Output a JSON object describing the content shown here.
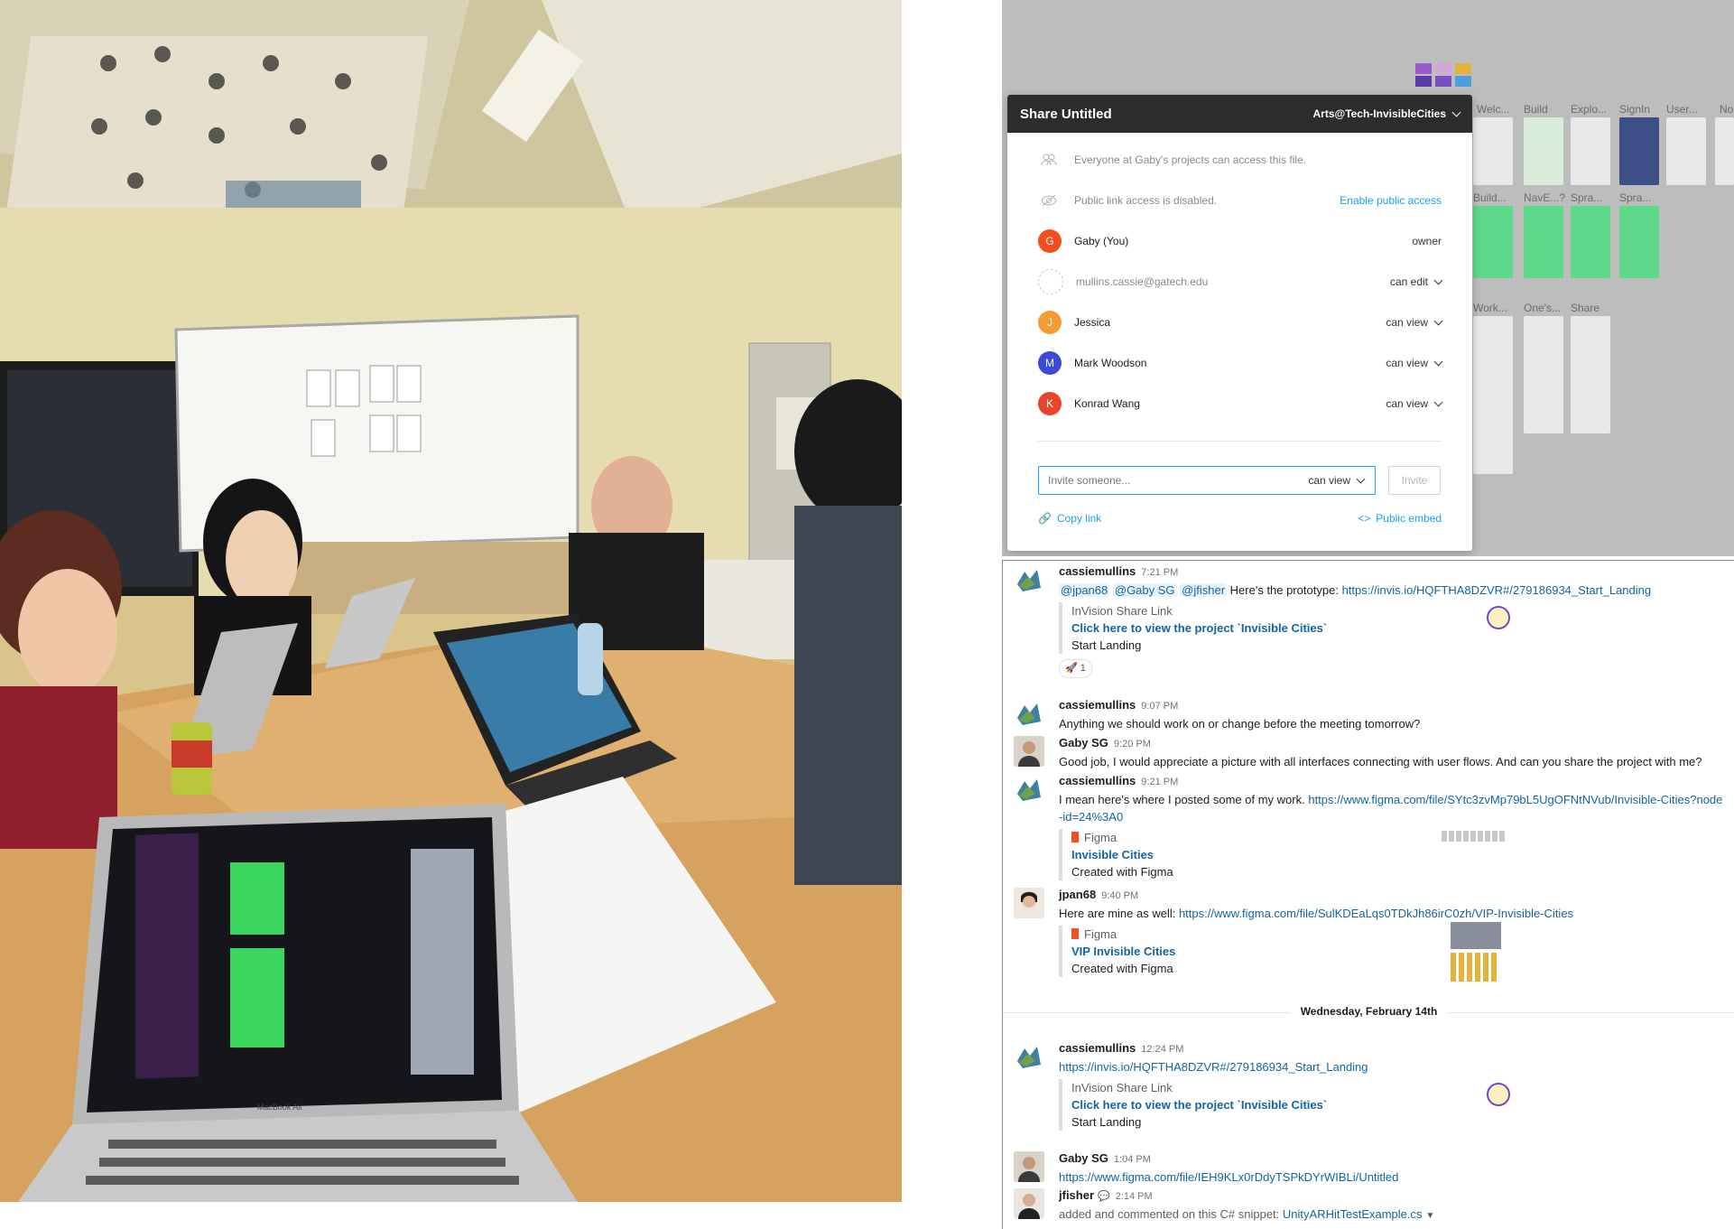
{
  "photo": {
    "description_icon": "team-meeting-photo",
    "laptop_label": "MacBook Air"
  },
  "figma": {
    "frames": [
      "Welc...",
      "Build",
      "Explo...",
      "SignIn",
      "User...",
      "No",
      "Build...",
      "NavE...?",
      "Spra...",
      "Spra...",
      "Work...",
      "One's...",
      "Share"
    ],
    "share": {
      "title": "Share Untitled",
      "team": "Arts@Tech-InvisibleCities",
      "access_everyone": "Everyone at Gaby's projects can access this file.",
      "public_link": "Public link access is disabled.",
      "enable_public": "Enable public access",
      "people": [
        {
          "initial": "G",
          "name": "Gaby (You)",
          "perm": "owner",
          "color": "#f24e1e",
          "has_dropdown": false
        },
        {
          "initial": "",
          "name": "mullins.cassie@gatech.edu",
          "perm": "can edit",
          "color": "#ffffff",
          "has_dropdown": true
        },
        {
          "initial": "J",
          "name": "Jessica",
          "perm": "can view",
          "color": "#f59b33",
          "has_dropdown": true
        },
        {
          "initial": "M",
          "name": "Mark Woodson",
          "perm": "can view",
          "color": "#3b4bd8",
          "has_dropdown": true
        },
        {
          "initial": "K",
          "name": "Konrad Wang",
          "perm": "can view",
          "color": "#e8442a",
          "has_dropdown": true
        }
      ],
      "invite_placeholder": "Invite someone...",
      "invite_perm": "can view",
      "invite_button": "Invite",
      "copy_link": "Copy link",
      "public_embed": "Public embed"
    }
  },
  "slack": {
    "m1": {
      "name": "cassiemullins",
      "time": "7:21 PM",
      "mentions": [
        "@jpan68",
        "@Gaby SG",
        "@jfisher"
      ],
      "text": "Here's the prototype:",
      "link": "https://invis.io/HQFTHA8DZVR#/279186934_Start_Landing",
      "attach_source": "InVision Share Link",
      "attach_title": "Click here to view the project `Invisible Cities`",
      "attach_desc": "Start Landing",
      "reaction": "🚀 1"
    },
    "m2": {
      "name": "cassiemullins",
      "time": "9:07 PM",
      "text": "Anything we should work on or change before the meeting tomorrow?"
    },
    "m3": {
      "name": "Gaby SG",
      "time": "9:20 PM",
      "text": "Good job, I would appreciate a picture with all interfaces connecting with user flows. And can you share the project with me?"
    },
    "m4": {
      "name": "cassiemullins",
      "time": "9:21 PM",
      "text": "I mean here's where I posted some of my work.",
      "link": "https://www.figma.com/file/SYtc3zvMp79bL5UgOFNtNVub/Invisible-Cities?node-id=24%3A0",
      "attach_source": "Figma",
      "attach_title": "Invisible Cities",
      "attach_desc": "Created with Figma"
    },
    "m5": {
      "name": "jpan68",
      "time": "9:40 PM",
      "text": "Here are mine as well:",
      "link": "https://www.figma.com/file/SulKDEaLqs0TDkJh86irC0zh/VIP-Invisible-Cities",
      "attach_source": "Figma",
      "attach_title": "VIP Invisible Cities",
      "attach_desc": "Created with Figma"
    },
    "day_divider": "Wednesday, February 14th",
    "m6": {
      "name": "cassiemullins",
      "time": "12:24 PM",
      "link": "https://invis.io/HQFTHA8DZVR#/279186934_Start_Landing",
      "attach_source": "InVision Share Link",
      "attach_title": "Click here to view the project `Invisible Cities`",
      "attach_desc": "Start Landing"
    },
    "m7": {
      "name": "Gaby SG",
      "time": "1:04 PM",
      "link": "https://www.figma.com/file/IEH9KLx0rDdyTSPkDYrWIBLi/Untitled"
    },
    "m8": {
      "name": "jfisher",
      "time": "2:14 PM",
      "text": "added and commented on this C# snippet:",
      "link": "UnityARHitTestExample.cs"
    }
  }
}
